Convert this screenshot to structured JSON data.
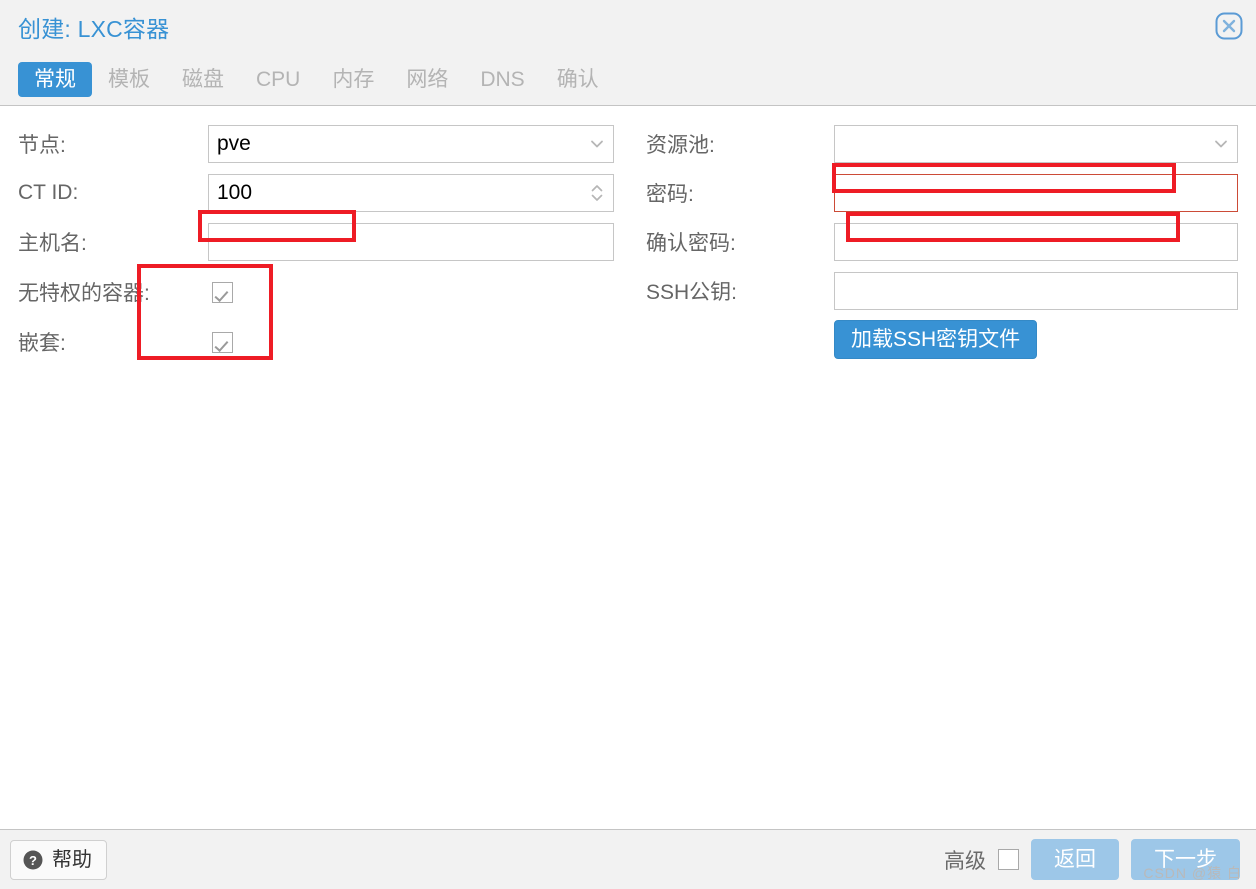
{
  "window": {
    "title": "创建: LXC容器",
    "close_icon": "close-circle-icon"
  },
  "colors": {
    "accent": "#3892d4",
    "header_bg": "#f2f2f2",
    "annotation_red": "#ee1c25",
    "invalid_border": "#cc4b37",
    "disabled_button": "#9dc7e8",
    "label_text": "#666666",
    "inactive_tab": "#b4b4b4"
  },
  "tabs": [
    {
      "label": "常规",
      "active": true
    },
    {
      "label": "模板",
      "active": false
    },
    {
      "label": "磁盘",
      "active": false
    },
    {
      "label": "CPU",
      "active": false
    },
    {
      "label": "内存",
      "active": false
    },
    {
      "label": "网络",
      "active": false
    },
    {
      "label": "DNS",
      "active": false
    },
    {
      "label": "确认",
      "active": false
    }
  ],
  "form": {
    "left": {
      "node": {
        "label": "节点:",
        "value": "pve",
        "placeholder": "",
        "trigger_icon": "chevron-down-icon"
      },
      "ctid": {
        "label": "CT ID:",
        "value": "100",
        "placeholder": "",
        "trigger_icon": "spinner-updown-icon"
      },
      "hostname": {
        "label": "主机名:",
        "value": "",
        "placeholder": ""
      },
      "unprivileged": {
        "label": "无特权的容器:",
        "checked": true
      },
      "nesting": {
        "label": "嵌套:",
        "checked": true
      }
    },
    "right": {
      "pool": {
        "label": "资源池:",
        "value": "",
        "placeholder": "",
        "trigger_icon": "chevron-down-icon"
      },
      "password": {
        "label": "密码:",
        "value": "",
        "placeholder": "",
        "invalid": true
      },
      "confirm_password": {
        "label": "确认密码:",
        "value": "",
        "placeholder": "",
        "invalid": false
      },
      "ssh_public_key": {
        "label": "SSH公钥:",
        "value": "",
        "placeholder": ""
      },
      "load_ssh_button": {
        "label": "加载SSH密钥文件"
      }
    }
  },
  "footer": {
    "help": {
      "label": "帮助",
      "icon": "question-circle-icon"
    },
    "advanced": {
      "label": "高级",
      "checked": false
    },
    "back": {
      "label": "返回"
    },
    "next": {
      "label": "下一步"
    }
  },
  "watermark": {
    "text": "CSDN @猿 白"
  }
}
